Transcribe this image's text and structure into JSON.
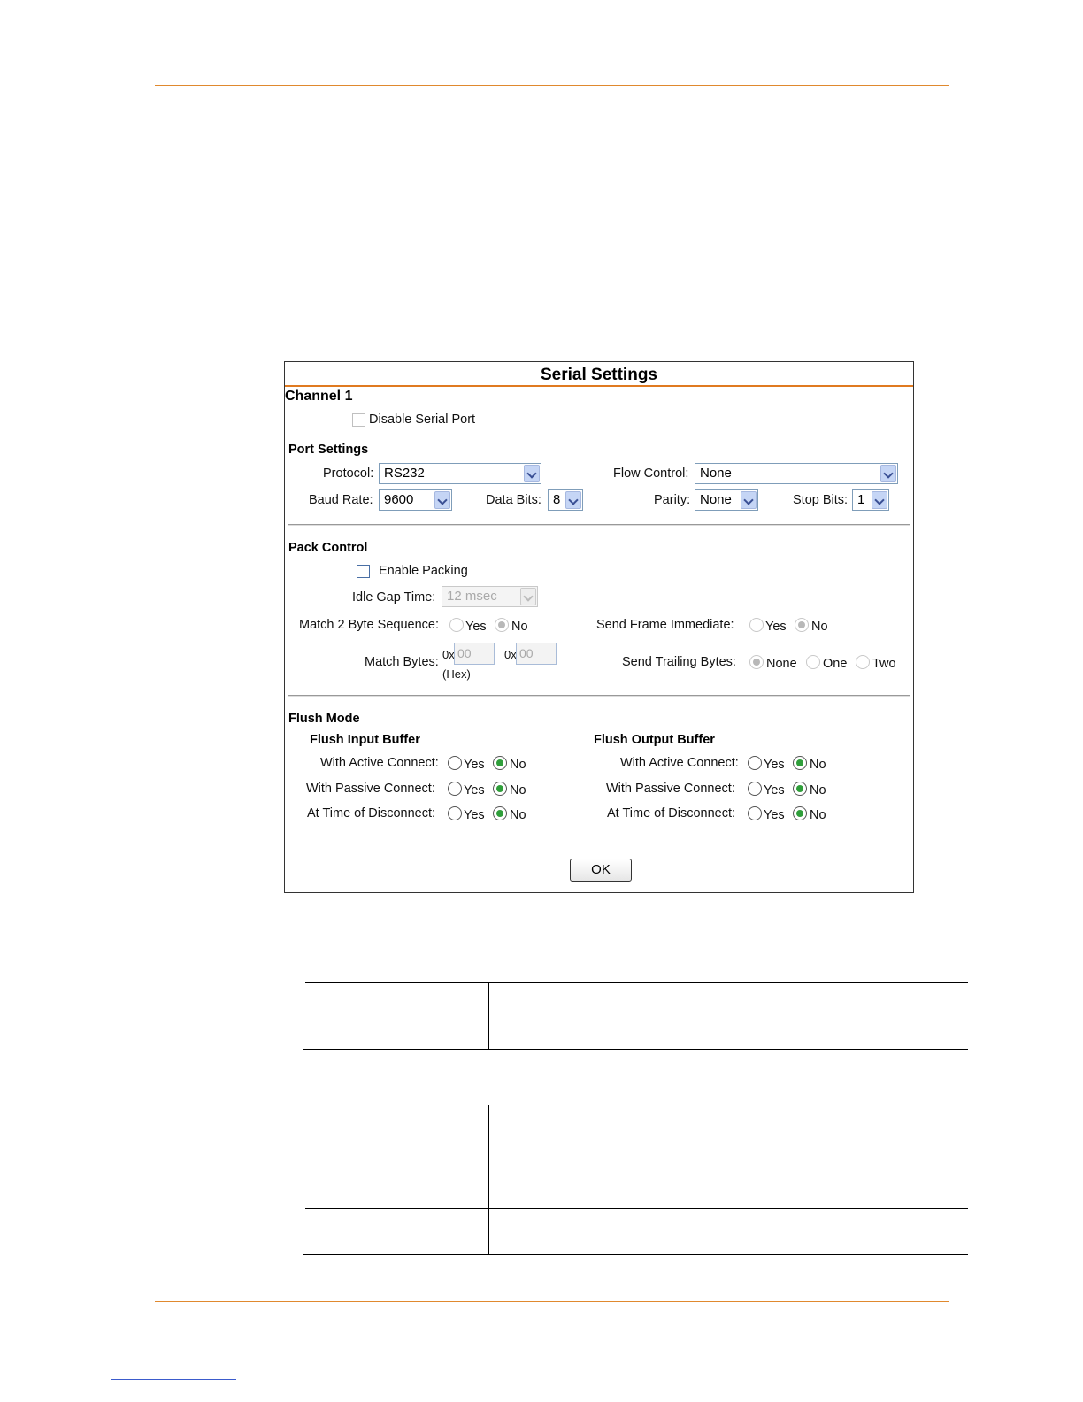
{
  "panel": {
    "title": "Serial Settings",
    "channel": "Channel 1",
    "disable_serial_port": "Disable Serial Port",
    "port_settings": {
      "heading": "Port Settings",
      "protocol_label": "Protocol:",
      "protocol_value": "RS232",
      "flow_control_label": "Flow Control:",
      "flow_control_value": "None",
      "baud_rate_label": "Baud Rate:",
      "baud_rate_value": "9600",
      "data_bits_label": "Data Bits:",
      "data_bits_value": "8",
      "parity_label": "Parity:",
      "parity_value": "None",
      "stop_bits_label": "Stop Bits:",
      "stop_bits_value": "1"
    },
    "pack_control": {
      "heading": "Pack Control",
      "enable_packing": "Enable Packing",
      "idle_gap_label": "Idle Gap Time:",
      "idle_gap_value": "12 msec",
      "match_seq_label": "Match 2 Byte Sequence:",
      "send_frame_label": "Send Frame Immediate:",
      "yes": "Yes",
      "no": "No",
      "match_bytes_label": "Match Bytes:",
      "hex_prefix": "0x",
      "hex_value_1": "00",
      "hex_value_2": "00",
      "hex_note": "(Hex)",
      "trailing_label": "Send Trailing Bytes:",
      "trailing_none": "None",
      "trailing_one": "One",
      "trailing_two": "Two"
    },
    "flush_mode": {
      "heading": "Flush Mode",
      "input_heading": "Flush Input Buffer",
      "output_heading": "Flush Output Buffer",
      "active_label": "With Active Connect:",
      "passive_label": "With Passive Connect:",
      "disconnect_label": "At Time of Disconnect:",
      "yes": "Yes",
      "no": "No"
    },
    "ok_label": "OK"
  }
}
